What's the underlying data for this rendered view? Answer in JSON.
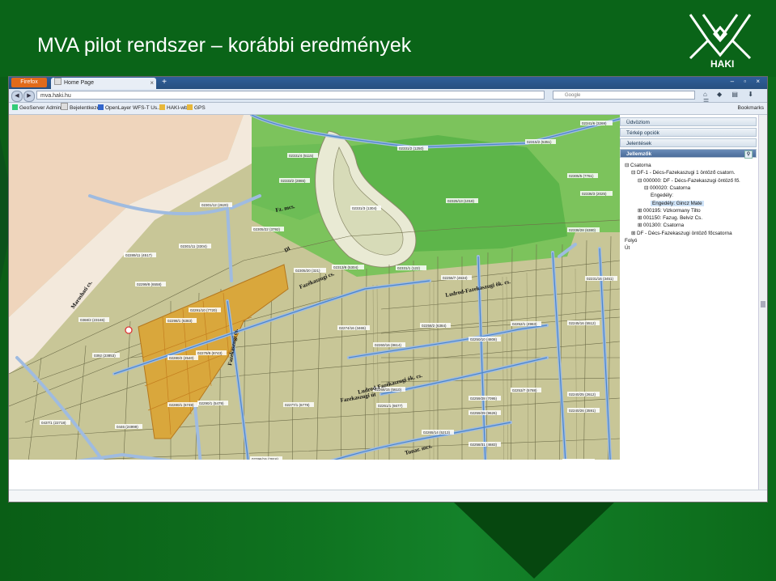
{
  "slide": {
    "title": "MVA pilot rendszer – korábbi eredmények",
    "logo_text": "HAKI",
    "logo_icon": "haki-logo-icon"
  },
  "browser": {
    "app_button": "Firefox",
    "tab_title": "Home Page",
    "new_tab": "+",
    "window_controls": "– ▫ ×",
    "url": "mva.haki.hu",
    "search_placeholder": "Google",
    "bookmarks": [
      {
        "label": "GeoServer Admin"
      },
      {
        "label": "Bejelentkezés"
      },
      {
        "label": "OpenLayer WFS-T Us..."
      },
      {
        "label": "HAKI-wb"
      },
      {
        "label": "GPS"
      }
    ],
    "bookmarks_menu": "Bookmarks"
  },
  "sidebar": {
    "panels": [
      {
        "label": "Üdvözlom"
      },
      {
        "label": "Térkép opciók"
      },
      {
        "label": "Jelentések"
      },
      {
        "label": "Jellemzők"
      }
    ],
    "tree": [
      {
        "label": "Csatorna"
      },
      {
        "label": "DF-1 - Décs-Fazekaszugi 1 öntöző csatorn."
      },
      {
        "label": "000000: DF - Décs-Fazekaszugi öntöző fő."
      },
      {
        "label": "000020: Csatorna"
      },
      {
        "label": "Engedély:"
      },
      {
        "label": "Engedély: Gincz Mate"
      },
      {
        "label": "000195: Vizkormany Tilto"
      },
      {
        "label": "001150: Fazug. Belviz Cs."
      },
      {
        "label": "001300: Csatorna"
      },
      {
        "label": "DF - Décs-Fazekaszugi öntöző főcsatorna"
      },
      {
        "label": "Folyó"
      },
      {
        "label": "Út"
      }
    ]
  },
  "map": {
    "street_labels": [
      "Fz. mcs.",
      "Dl",
      "Fazékaszugi cs.",
      "Fazekaszugi cs.",
      "Fazekaszugi út",
      "Ludrod-Fazekaszugi ök. cs.",
      "Ludrod-Fazékaszugi ök. cs.",
      "Tunar. mcs.",
      "Maroshati cs."
    ],
    "parcel_labels": [
      "02331/4 (5115)",
      "02331/2 (1250)",
      "02315/2 (5351)",
      "02333/2 (2865)",
      "02331/3 (1304)",
      "02325/13 (1018)",
      "02301/12 (2620)",
      "02305/22 (3792)",
      "02301/11 (3304)",
      "02289/11 (4517)",
      "02305/20 (321)",
      "02313/8 (5304)",
      "02331/1 (122)",
      "02299/8 (6558)",
      "02256/7 (4634)",
      "02341/6 (3269)",
      "02305/5 (7761)",
      "02336/3 (2025)",
      "02338/28 (6380)",
      "02291/10 (7720)",
      "02298/1 (6383)",
      "02279/9 (8743)",
      "02280/2 (2540)",
      "02274/16 (3465)",
      "02260/16 (8614)",
      "02258/2 (6384)",
      "02250/10 (4808)",
      "02252/1 (4963)",
      "02245/16 (5512)",
      "02231/16 (3451)",
      "02280/1 (6749)",
      "02290/1 (5479)",
      "02277/1 (6779)",
      "02268/15 (5610)",
      "02261/1 (6677)",
      "02259/28 (7095)",
      "02259/29 (9626)",
      "02253/7 (5788)",
      "02240/25 (2612)",
      "02240/26 (3591)",
      "02265/14 (5213)",
      "02258/31 (4683)",
      "02254/16 (4172)",
      "02247/16 (4236)",
      "02276/1 (2564)",
      "02260/10 (9406)",
      "02258/38 (6138)",
      "02296/16 (2916)",
      "02294/14 (2197)",
      "0437/1 (22718)",
      "0446 (24999)",
      "0437/2 (23423)",
      "0392 (23853)",
      "0368/2 (23165)"
    ]
  }
}
